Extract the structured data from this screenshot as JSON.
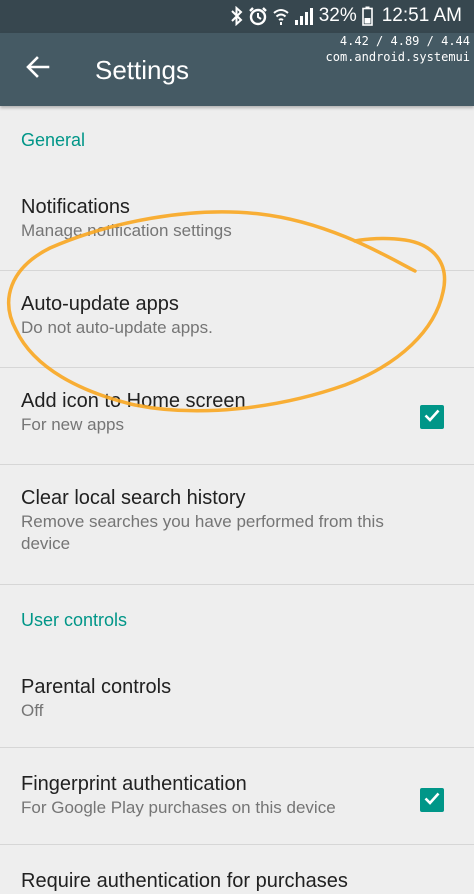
{
  "status_bar": {
    "battery_percent": "32%",
    "time": "12:51 AM",
    "icons": [
      "bluetooth-icon",
      "alarm-icon",
      "wifi-icon",
      "signal-icon",
      "battery-icon"
    ]
  },
  "debug_overlay": {
    "load_a": "4.42",
    "load_b": "4.89",
    "load_c": "4.44",
    "separator": " / ",
    "process": "com.android.systemui"
  },
  "app_bar": {
    "title": "Settings",
    "back_icon": "arrow-back-icon"
  },
  "sections": {
    "general": {
      "header": "General",
      "notifications": {
        "title": "Notifications",
        "subtitle": "Manage notification settings"
      },
      "auto_update": {
        "title": "Auto-update apps",
        "subtitle": "Do not auto-update apps."
      },
      "add_icon": {
        "title": "Add icon to Home screen",
        "subtitle": "For new apps",
        "checked": true
      },
      "clear_history": {
        "title": "Clear local search history",
        "subtitle": "Remove searches you have performed from this device"
      }
    },
    "user_controls": {
      "header": "User controls",
      "parental": {
        "title": "Parental controls",
        "subtitle": "Off"
      },
      "fingerprint": {
        "title": "Fingerprint authentication",
        "subtitle": "For Google Play purchases on this device",
        "checked": true
      },
      "require_auth": {
        "title": "Require authentication for purchases"
      }
    }
  },
  "colors": {
    "status_bar": "#37474f",
    "app_bar": "#455a64",
    "accent": "#009688",
    "background": "#eeeeee",
    "annotation": "#f9a825"
  }
}
